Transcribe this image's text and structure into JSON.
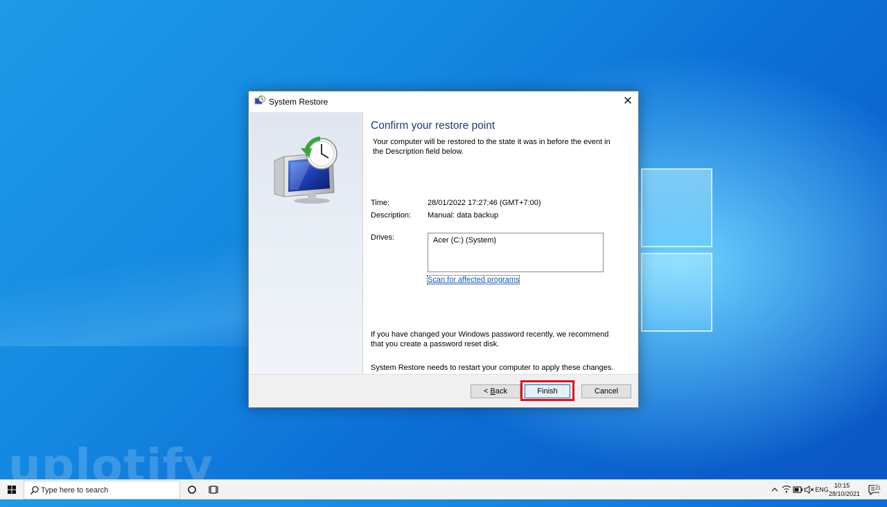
{
  "dialog": {
    "title": "System Restore",
    "close_glyph": "✕",
    "heading": "Confirm your restore point",
    "description": "Your computer will be restored to the state it was in before the event in the Description field below.",
    "time_label": "Time:",
    "time_value": "28/01/2022 17:27:46 (GMT+7:00)",
    "description_label": "Description:",
    "description_value": "Manual: data backup",
    "drives_label": "Drives:",
    "drives": [
      "Acer (C:) (System)"
    ],
    "scan_link": "Scan for affected programs",
    "password_note": "If you have changed your Windows password recently, we recommend that you create a password reset disk.",
    "restart_note": "System Restore needs to restart your computer to apply these changes. Before you proceed, save any open files and close all programs.",
    "back_prefix": "< ",
    "back_accel": "B",
    "back_rest": "ack",
    "finish_label": "Finish",
    "cancel_label": "Cancel",
    "highlight_color": "#e10f18"
  },
  "watermark": "uplotify",
  "taskbar": {
    "search_placeholder": "Type here to search",
    "language": "ENG",
    "time": "10:15",
    "date": "28/10/2021",
    "notification_count": "21",
    "icons": [
      "windows-start-icon",
      "search-icon",
      "cortana-circle-icon",
      "task-view-icon",
      "chevron-up-icon",
      "wifi-icon",
      "battery-icon",
      "volume-muted-icon",
      "notification-icon"
    ]
  }
}
